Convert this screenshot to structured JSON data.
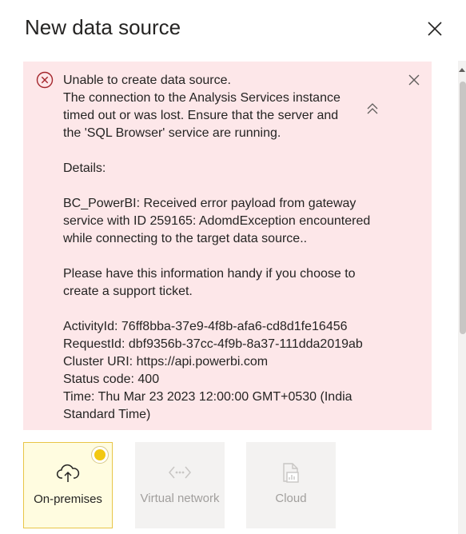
{
  "panel": {
    "title": "New data source"
  },
  "error": {
    "lines": [
      "Unable to create data source.",
      "The connection to the Analysis Services instance",
      "timed out or was lost. Ensure that the server and",
      "the 'SQL Browser' service are running.",
      "",
      "Details:",
      "",
      "BC_PowerBI: Received error payload from gateway",
      "service with ID 259165: AdomdException encountered",
      "while connecting to the target data source..",
      "",
      "Please have this information handy if you choose to",
      "create a support ticket.",
      "",
      "ActivityId: 76ff8bba-37e9-4f8b-afa6-cd8d1fe16456",
      "RequestId: dbf9356b-37cc-4f9b-8a37-111dda2019ab",
      "Cluster URI: https://api.powerbi.com",
      "Status code: 400",
      "Time: Thu Mar 23 2023 12:00:00 GMT+0530 (India",
      "Standard Time)"
    ],
    "icons": {
      "error": "error-circle-icon",
      "dismiss": "close-icon",
      "collapse": "chevron-double-up-icon"
    },
    "colors": {
      "background": "#fde7e9",
      "icon": "#a4262c"
    }
  },
  "connection_types": {
    "options": [
      {
        "label": "On-premises",
        "icon": "cloud-upload-icon",
        "selected": true,
        "enabled": true
      },
      {
        "label": "Virtual network",
        "icon": "virtual-network-icon",
        "selected": false,
        "enabled": false
      },
      {
        "label": "Cloud",
        "icon": "cloud-report-icon",
        "selected": false,
        "enabled": false
      }
    ],
    "accent_color": "#f2c811"
  }
}
